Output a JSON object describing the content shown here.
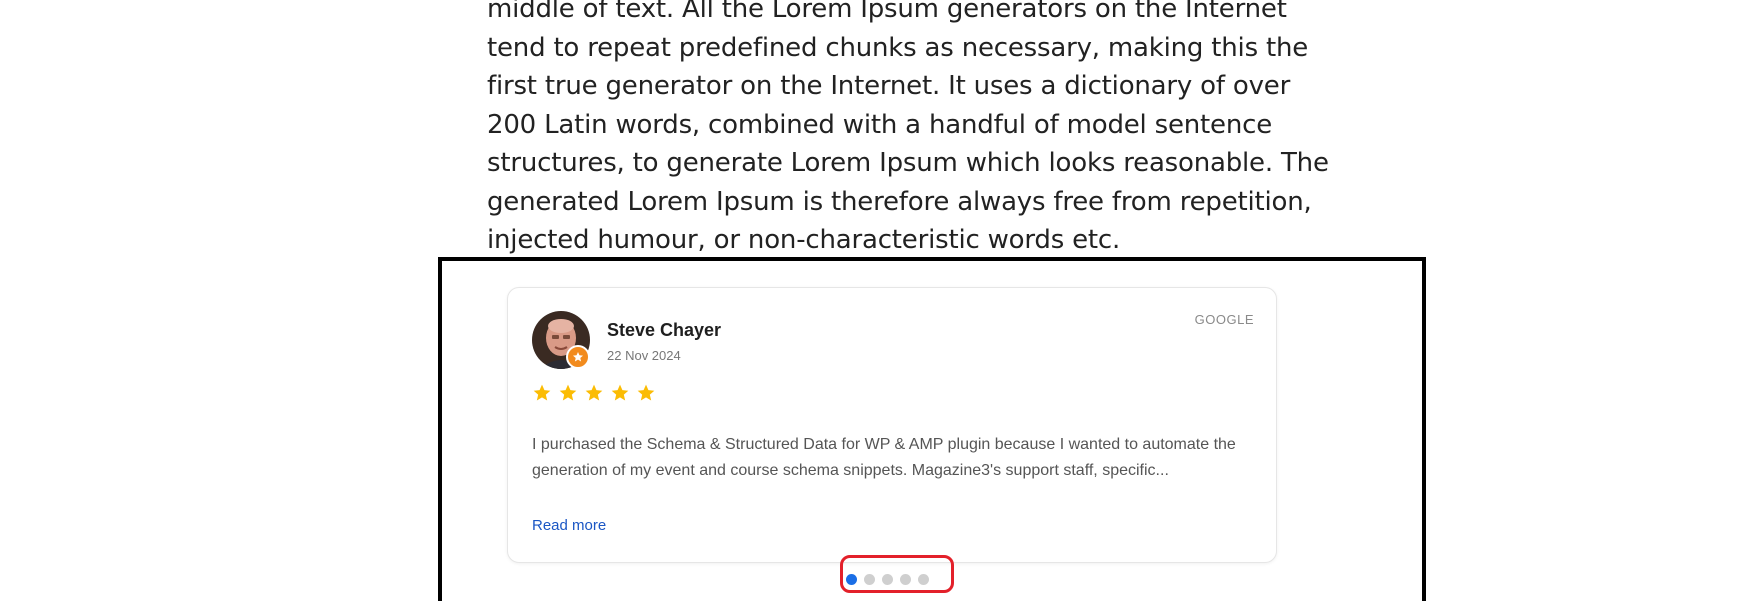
{
  "article": {
    "lines": [
      "middle of text. All the Lorem Ipsum generators on the Internet",
      "tend to repeat predefined chunks as necessary, making this the",
      "first true generator on the Internet. It uses a dictionary of over",
      "200 Latin words, combined with a handful of model sentence",
      "structures, to generate Lorem Ipsum which looks reasonable. The",
      "generated Lorem Ipsum is therefore always free from repetition,",
      "injected humour, or non-characteristic words etc."
    ]
  },
  "review": {
    "reviewer_name": "Steve Chayer",
    "date": "22 Nov 2024",
    "source": "GOOGLE",
    "rating": 5,
    "text_lines": [
      "I purchased the Schema & Structured Data for WP & AMP plugin because I wanted to automate the",
      "generation of my event and course schema snippets. Magazine3's support staff, specific..."
    ],
    "read_more_label": "Read more",
    "avatar_icon": "reviewer-photo",
    "badge_icon": "star-badge-icon"
  },
  "carousel": {
    "total_slides": 5,
    "active_index": 0
  },
  "colors": {
    "star": "#fbbc04",
    "link": "#1a56c4",
    "active_dot": "#1a6ee6",
    "inactive_dot": "#cfcfcf",
    "highlight": "#e3202a",
    "badge": "#f28b1e"
  }
}
